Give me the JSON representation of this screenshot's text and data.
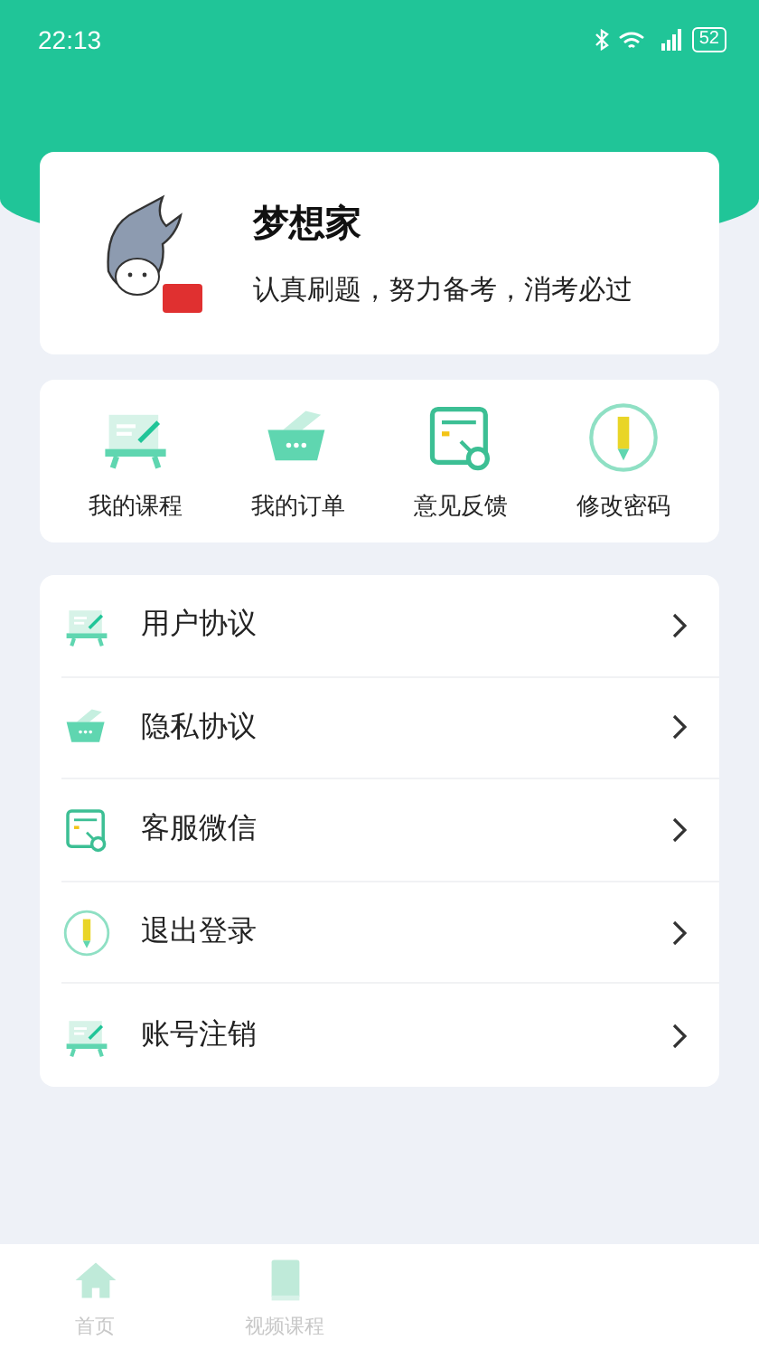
{
  "status_bar": {
    "time": "22:13",
    "battery": "52"
  },
  "profile": {
    "name": "梦想家",
    "motto": "认真刷题，努力备考，消考必过"
  },
  "shortcuts": [
    {
      "kind": "easel",
      "label": "我的课程"
    },
    {
      "kind": "basket",
      "label": "我的订单"
    },
    {
      "kind": "feedback",
      "label": "意见反馈"
    },
    {
      "kind": "pencil",
      "label": "修改密码"
    }
  ],
  "menu": [
    {
      "kind": "easel",
      "label": "用户协议"
    },
    {
      "kind": "basket",
      "label": "隐私协议"
    },
    {
      "kind": "feedback",
      "label": "客服微信"
    },
    {
      "kind": "pencil",
      "label": "退出登录"
    },
    {
      "kind": "easel",
      "label": "账号注销"
    }
  ],
  "tab_bar": [
    {
      "kind": "home",
      "label": "首页",
      "selected": false
    },
    {
      "kind": "book",
      "label": "视频课程",
      "selected": false
    }
  ]
}
